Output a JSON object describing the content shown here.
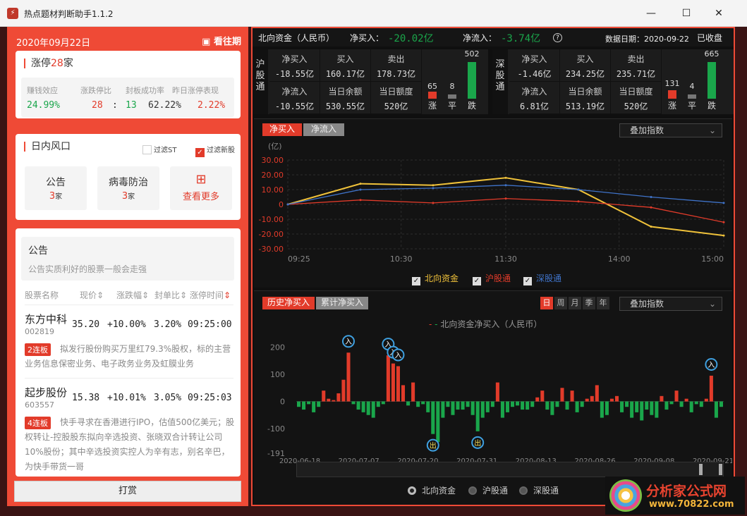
{
  "window": {
    "title": "热点题材判断助手1.1.2"
  },
  "left": {
    "date": "2020年09月22日",
    "history_label": "看往期",
    "limit_up": {
      "title_prefix": "涨停",
      "count": "28",
      "title_suffix": "家",
      "labels": [
        "赚钱效应",
        "涨跌停比",
        "封板成功率",
        "昨日涨停表现"
      ],
      "earning_effect": "24.99%",
      "up_count": "28",
      "sep": ":",
      "down_count": "13",
      "seal_rate": "62.22%",
      "yesterday_perf": "2.22%"
    },
    "intraday": {
      "title": "日内风口",
      "filter_st": "过滤ST",
      "filter_new": "过滤新股",
      "tiles": [
        {
          "name": "公告",
          "count": "3",
          "unit": "家"
        },
        {
          "name": "病毒防治",
          "count": "3",
          "unit": "家"
        }
      ],
      "more": "查看更多"
    },
    "notice": {
      "title": "公告",
      "desc": "公告实质利好的股票一般会走强"
    },
    "table_headers": [
      "股票名称",
      "现价",
      "涨跌幅",
      "封单比",
      "涨停时间"
    ],
    "stocks": [
      {
        "name": "东方中科",
        "code": "002819",
        "price": "35.20",
        "change": "+10.00%",
        "ratio": "3.20%",
        "time": "09:25:00",
        "tag": "2连板",
        "desc": "拟发行股份购买万里红79.3%股权，标的主营业务信息保密业务、电子政务业务及虹膜业务"
      },
      {
        "name": "起步股份",
        "code": "603557",
        "price": "15.38",
        "change": "+10.01%",
        "ratio": "3.05%",
        "time": "09:25:03",
        "tag": "4连板",
        "desc": "快手寻求在香港进行IPO，估值500亿美元；股权转让-控股股东拟向辛选投资、张晓双合计转让公司10%股份；其中辛选投资实控人为辛有志，别名辛巴，为快手带货一哥"
      }
    ],
    "reward_button": "打赏"
  },
  "header": {
    "title": "北向资金（人民币）",
    "net_buy_label": "净买入：",
    "net_buy": "-20.02亿",
    "net_in_label": "净流入：",
    "net_in": "-3.74亿",
    "help_icon": "?",
    "date_label": "数据日期：2020-09-22",
    "status": "已收盘"
  },
  "sh": {
    "name": "沪股通",
    "net_buy_label": "净买入",
    "net_buy": "-18.55亿",
    "buy_label": "买入",
    "buy": "160.17亿",
    "sell_label": "卖出",
    "sell": "178.73亿",
    "net_in_label": "净流入",
    "net_in": "-10.55亿",
    "balance_label": "当日余额",
    "balance": "530.55亿",
    "quota_label": "当日额度",
    "quota": "520亿",
    "up": "65",
    "flat": "8",
    "down": "502",
    "up_l": "涨",
    "flat_l": "平",
    "down_l": "跌"
  },
  "sz": {
    "name": "深股通",
    "net_buy_label": "净买入",
    "net_buy": "-1.46亿",
    "buy_label": "买入",
    "buy": "234.25亿",
    "sell_label": "卖出",
    "sell": "235.71亿",
    "net_in_label": "净流入",
    "net_in": "6.81亿",
    "balance_label": "当日余额",
    "balance": "513.19亿",
    "quota_label": "当日额度",
    "quota": "520亿",
    "up": "131",
    "flat": "4",
    "down": "665",
    "up_l": "涨",
    "flat_l": "平",
    "down_l": "跌"
  },
  "intraday_chart": {
    "tabs": [
      "净买入",
      "净流入"
    ],
    "overlay": "叠加指数",
    "unit": "(亿)",
    "y_ticks": [
      "30.00",
      "20.00",
      "10.00",
      "0",
      "-10.00",
      "-20.00",
      "-30.00"
    ],
    "x_ticks": [
      "09:25",
      "10:30",
      "11:30",
      "14:00",
      "15:00"
    ],
    "legend": [
      "北向资金",
      "沪股通",
      "深股通"
    ]
  },
  "history_chart": {
    "tabs": [
      "历史净买入",
      "累计净买入"
    ],
    "periods": [
      "日",
      "周",
      "月",
      "季",
      "年"
    ],
    "overlay": "叠加指数",
    "legend": "北向资金净买入（人民币）",
    "y_ticks": [
      "200",
      "100",
      "0",
      "-100",
      "-191"
    ],
    "x_ticks": [
      "2020-06-18",
      "2020-07-07",
      "2020-07-20",
      "2020-07-31",
      "2020-08-13",
      "2020-08-26",
      "2020-09-08",
      "2020-09-21"
    ],
    "in_label": "入",
    "out_label": "出",
    "radios": [
      "北向资金",
      "沪股通",
      "深股通"
    ]
  },
  "colors": {
    "accent": "#ef4a36",
    "up": "#e23b2a",
    "down": "#1aa64b",
    "north": "#f0c23a",
    "sh": "#e23b2a",
    "sz": "#3f73c9"
  },
  "brand": {
    "name": "分析家公式网",
    "url": "www.70822.com"
  },
  "chart_data": [
    {
      "type": "line",
      "title": "",
      "ylabel": "(亿)",
      "ylim": [
        -30,
        30
      ],
      "x": [
        "09:25",
        "10:30",
        "11:30",
        "14:00",
        "15:00"
      ],
      "series": [
        {
          "name": "北向资金",
          "values": [
            0,
            14,
            13,
            18,
            10,
            -15,
            -21
          ]
        },
        {
          "name": "沪股通",
          "values": [
            0,
            3,
            1,
            4,
            2,
            -2,
            -12
          ]
        },
        {
          "name": "深股通",
          "values": [
            0,
            10,
            11,
            13,
            10,
            5,
            1
          ]
        }
      ]
    },
    {
      "type": "bar",
      "title": "北向资金净买入（人民币）",
      "ylim": [
        -191,
        230
      ],
      "x": [
        "2020-06-18",
        "2020-07-07",
        "2020-07-20",
        "2020-07-31",
        "2020-08-13",
        "2020-08-26",
        "2020-09-08",
        "2020-09-21"
      ],
      "values": [
        -20,
        -30,
        -10,
        -40,
        -20,
        40,
        10,
        5,
        30,
        80,
        180,
        -10,
        -30,
        -40,
        -50,
        -60,
        -20,
        -10,
        170,
        140,
        130,
        60,
        -15,
        70,
        -20,
        -10,
        -40,
        -120,
        -150,
        -60,
        -20,
        -50,
        -30,
        -30,
        -20,
        -50,
        -110,
        -60,
        -40,
        -20,
        70,
        -60,
        -40,
        -20,
        -15,
        -30,
        -30,
        -20,
        15,
        40,
        -30,
        -50,
        -20,
        50,
        -30,
        40,
        -40,
        -20,
        10,
        20,
        60,
        -60,
        -50,
        10,
        20,
        -40,
        -20,
        -60,
        -40,
        -70,
        -30,
        -50,
        -60,
        20,
        -30,
        -10,
        40,
        -20,
        10,
        -40,
        -10,
        -20,
        10,
        95,
        -60,
        -20
      ]
    }
  ]
}
